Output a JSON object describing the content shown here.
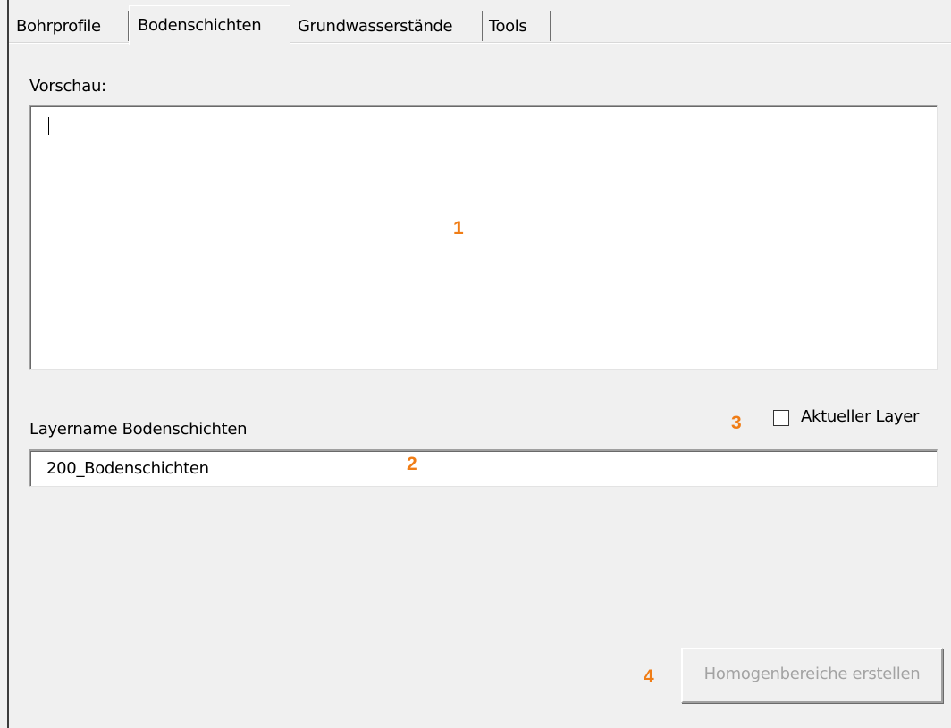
{
  "tabs": [
    {
      "label": "Bohrprofile",
      "active": false
    },
    {
      "label": "Bodenschichten",
      "active": true
    },
    {
      "label": "Grundwasserstände",
      "active": false
    },
    {
      "label": "Tools",
      "active": false
    }
  ],
  "preview": {
    "label": "Vorschau:",
    "value": ""
  },
  "layer": {
    "label": "Layername Bodenschichten",
    "value": "200_Bodenschichten",
    "current_layer_label": "Aktueller Layer",
    "current_layer_checked": false
  },
  "button": {
    "label": "Homogenbereiche erstellen",
    "enabled": false
  },
  "markers": {
    "m1": "1",
    "m2": "2",
    "m3": "3",
    "m4": "4"
  },
  "colors": {
    "background": "#f0f0f0",
    "marker": "#f07d16",
    "disabled_text": "#a3a3a3"
  }
}
